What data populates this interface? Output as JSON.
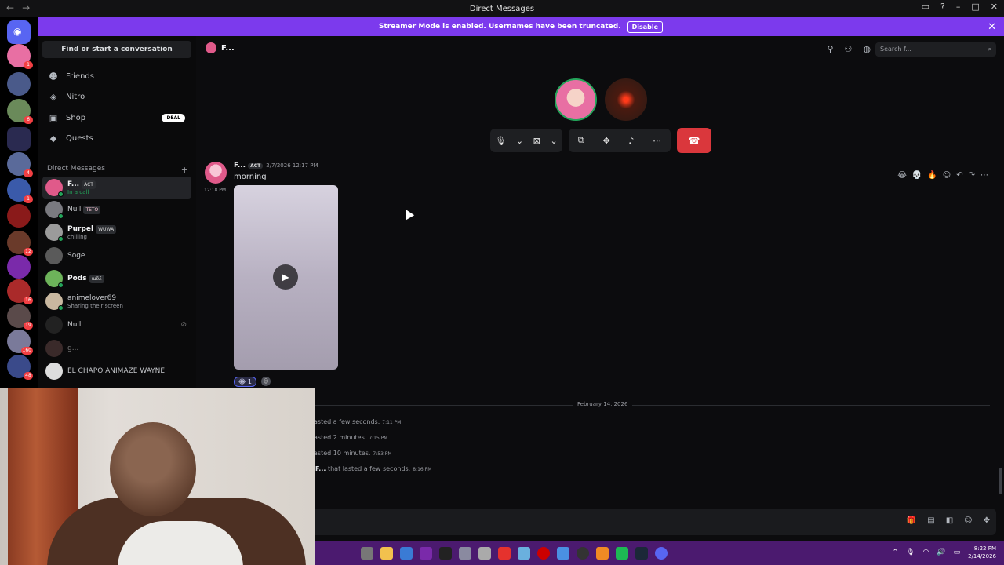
{
  "window": {
    "title": "Direct Messages"
  },
  "banner": {
    "text": "Streamer Mode is enabled. Usernames have been truncated.",
    "button": "Disable"
  },
  "sidebar": {
    "find_label": "Find or start a conversation",
    "nav": [
      {
        "label": "Friends",
        "icon": "friends-icon"
      },
      {
        "label": "Nitro",
        "icon": "nitro-icon"
      },
      {
        "label": "Shop",
        "icon": "shop-icon",
        "badge": "DEAL"
      },
      {
        "label": "Quests",
        "icon": "quests-icon"
      }
    ],
    "dm_header": "Direct Messages",
    "dms": [
      {
        "name": "F...",
        "tag": "ACT",
        "status": "In a call",
        "color": "#e05a8a"
      },
      {
        "name": "Null",
        "tag": "TETO",
        "status": "",
        "color": "#7a7a80"
      },
      {
        "name": "Purpel",
        "tag": "WUWA",
        "status": "chilling",
        "color": "#9b9b9b"
      },
      {
        "name": "Soge",
        "tag": "",
        "status": "",
        "color": "#5a5a5a"
      },
      {
        "name": "Pods",
        "tag": "ɯɐ̃ʎ",
        "status": "",
        "color": "#6db35a"
      },
      {
        "name": "animelover69",
        "tag": "",
        "status": "Sharing their screen",
        "color": "#c9b8a0"
      },
      {
        "name": "Null",
        "tag": "",
        "status": "",
        "color": "#222"
      },
      {
        "name": "g...",
        "tag": "",
        "status": "",
        "color": "#3a2a2a"
      },
      {
        "name": "EL CHAPO ANIMAZE WAYNE",
        "tag": "",
        "status": "",
        "color": "#ddd"
      }
    ]
  },
  "channel": {
    "name": "F...",
    "search_placeholder": "Search f..."
  },
  "call": {
    "avatar1_color": "#e86fa3",
    "avatar2_color": "#8a2a1a"
  },
  "message": {
    "author": "F...",
    "tag": "ACT",
    "timestamp": "2/7/2026 12:17 PM",
    "text": "morning",
    "side_time": "12:18 PM",
    "reaction_count": "1"
  },
  "divider": {
    "date": "February 14, 2026"
  },
  "system_messages": [
    {
      "text": "asted a few seconds.",
      "time": "7:11 PM"
    },
    {
      "text": "asted 2 minutes.",
      "time": "7:15 PM"
    },
    {
      "text": "asted 10 minutes.",
      "time": "7:53 PM"
    },
    {
      "author": "F...",
      "text": "that lasted a few seconds.",
      "time": "8:16 PM"
    }
  ],
  "taskbar": {
    "time": "8:22 PM",
    "date": "2/14/2026"
  },
  "colors": {
    "accent": "#5865f2",
    "banner": "#7c3aed",
    "danger": "#da373c",
    "taskbar": "#4b1a6f"
  }
}
